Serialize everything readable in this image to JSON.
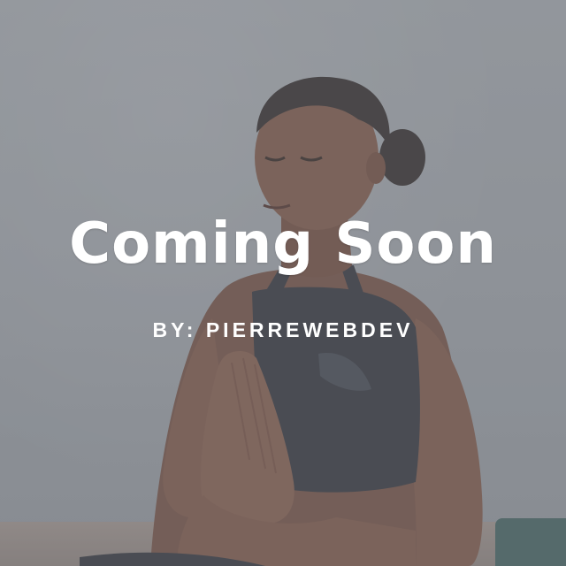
{
  "hero": {
    "title": "Coming Soon",
    "byline": "BY: PIERREWEBDEV"
  },
  "colors": {
    "text": "#ffffff",
    "overlay": "#7d8288",
    "wall": "#9fa4a8",
    "skin": "#7a5240",
    "top": "#2a2d33",
    "mat": "#3c5d5a"
  },
  "image": {
    "subject": "woman-meditating-photo"
  }
}
